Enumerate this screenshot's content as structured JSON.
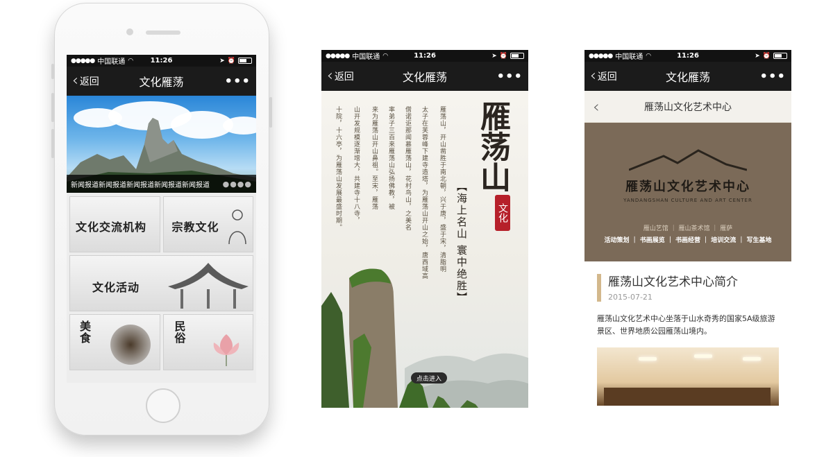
{
  "status_bar": {
    "signal_dots": "●●●●●",
    "carrier": "中国联通",
    "time": "11:26"
  },
  "nav": {
    "back_label": "返回",
    "more_label": "•••"
  },
  "screen1": {
    "title": "文化雁荡",
    "hero_caption": "新闻报道新闻报道新闻报道新闻报道新闻报道",
    "pager_dots": "●●●●",
    "tiles": [
      "文化交流机构",
      "宗教文化",
      "文化活动",
      "美食",
      "民俗"
    ]
  },
  "screen2": {
    "title": "文化雁荡",
    "big_title": "雁荡山",
    "seal": "文化",
    "slogan": "【海上名山 寰中绝胜】",
    "columns": [
      "雁荡山，开山凿胜于南北朝，兴于唐，盛于宋，清脂明",
      "太子在芙蓉峰下建寺造塔，为雁荡山开山之始，唐西域高",
      "僧诺讵那闻慕雁荡山，花村鸟山，之美名",
      "率弟子三百来雁荡山弘扬佛教，被",
      "来为雁荡山开山鼻祖。至宋，雁荡",
      "山开发规模逐渐增大，共建寺十八寺，",
      "十院，十六亭，为雁荡山发展最盛时期。"
    ],
    "enter_button": "点击进入"
  },
  "screen3": {
    "title": "文化雁荡",
    "sub_title": "雁荡山文化艺术中心",
    "banner": {
      "logo_cn": "雁荡山文化艺术中心",
      "logo_en": "YANDANGSHAN CULTURE AND ART CENTER",
      "line1": "雁山艺馆 ｜ 雁山茶术馆 ｜ 雁萨",
      "line2": "活动策划 ｜ 书画展览 ｜ 书画经营 ｜ 培训交流 ｜ 写生基地"
    },
    "article": {
      "title": "雁荡山文化艺术中心简介",
      "date": "2015-07-21",
      "body": "雁荡山文化艺术中心坐落于山水奇秀的国家5A级旅游景区、世界地质公园雁荡山境内。"
    }
  },
  "colors": {
    "bar_dark": "#121212",
    "nav_dark": "#1b1b1b",
    "seal_red": "#b6202a",
    "accent_tan": "#d3b88c",
    "banner_brown": "#7b6a58"
  }
}
